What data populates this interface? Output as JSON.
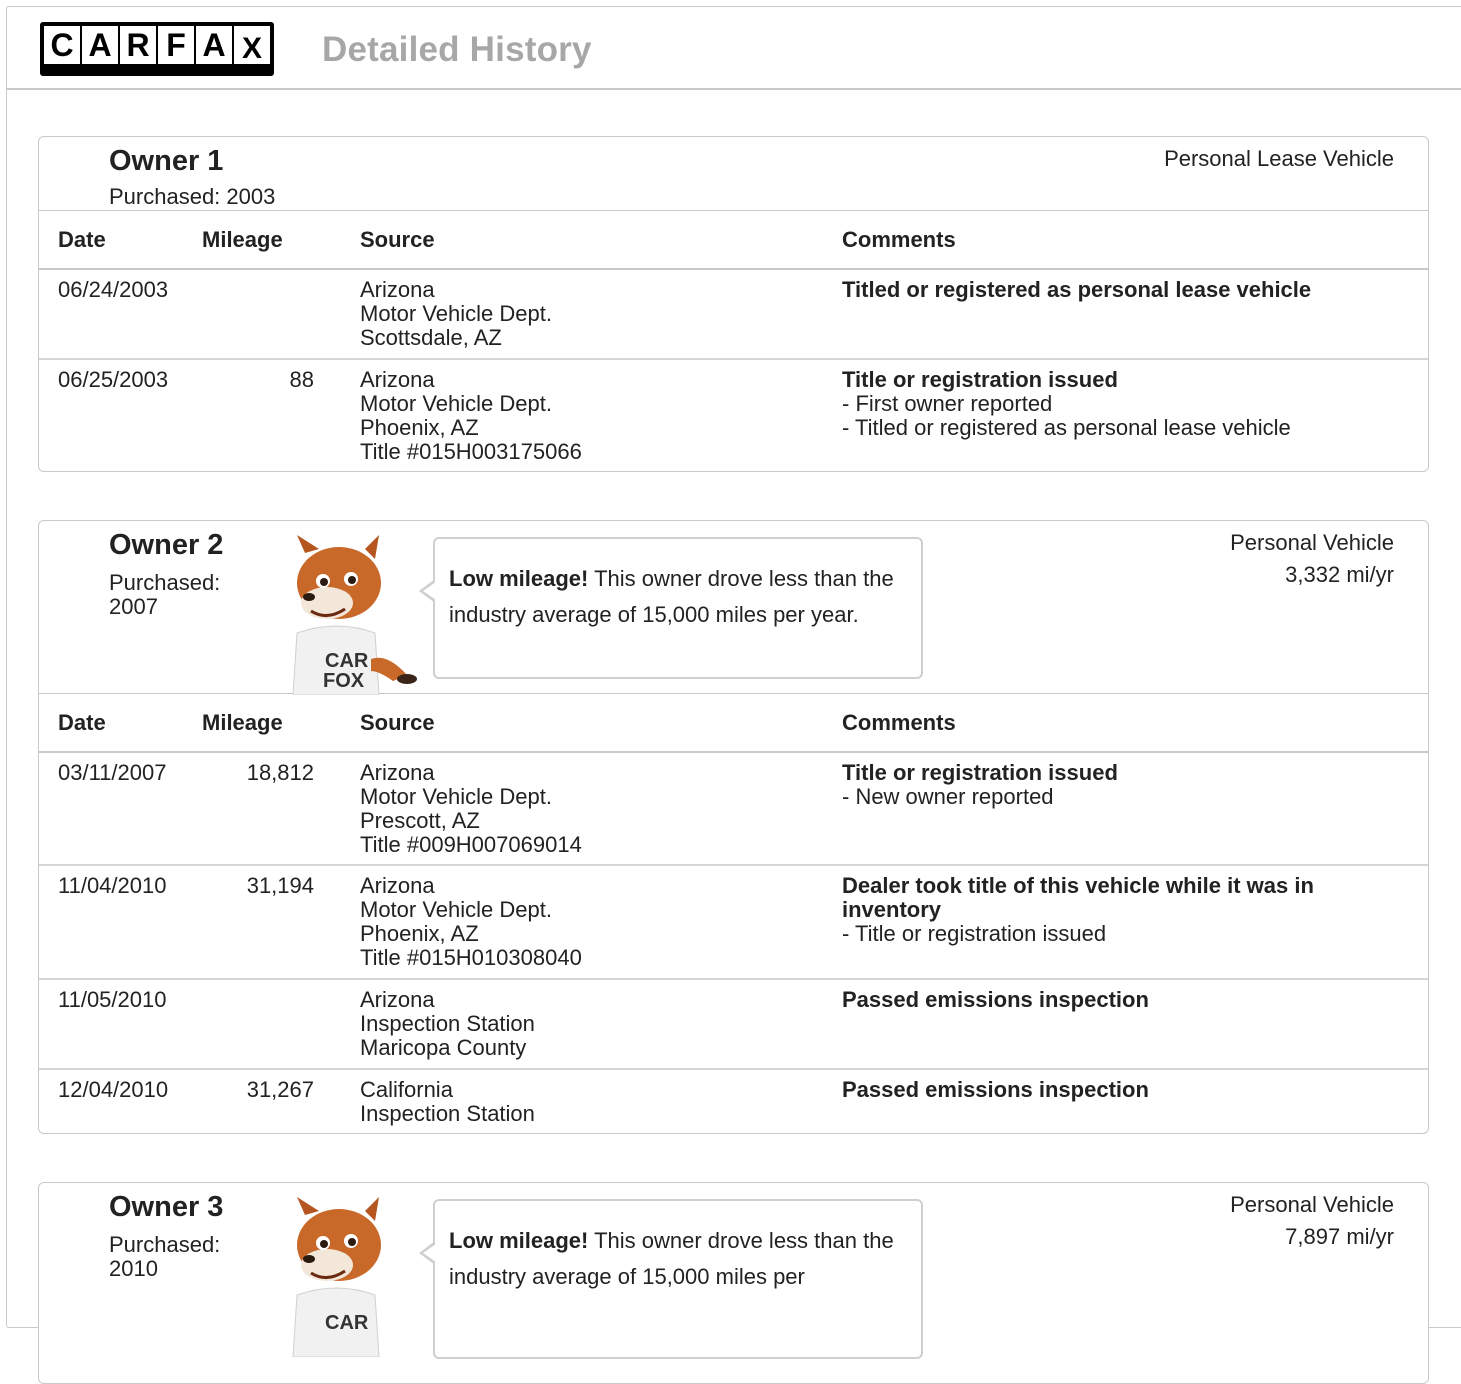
{
  "header": {
    "logo_letters": [
      "C",
      "A",
      "R",
      "F",
      "A",
      "X"
    ],
    "title": "Detailed History"
  },
  "columns": {
    "date": "Date",
    "mileage": "Mileage",
    "source": "Source",
    "comments": "Comments"
  },
  "owners": [
    {
      "name": "Owner 1",
      "purchased_label": "Purchased: 2003",
      "purchased_year": "",
      "vehicle_type": "Personal Lease Vehicle",
      "mileage_per_year": "",
      "rows": [
        {
          "date": "06/24/2003",
          "mileage": "",
          "source": [
            "Arizona",
            "Motor Vehicle Dept.",
            "Scottsdale, AZ"
          ],
          "comment_title": "Titled or registered as personal lease vehicle",
          "comment_details": []
        },
        {
          "date": "06/25/2003",
          "mileage": "88",
          "source": [
            "Arizona",
            "Motor Vehicle Dept.",
            "Phoenix, AZ",
            "Title #015H003175066"
          ],
          "comment_title": "Title or registration issued",
          "comment_details": [
            "- First owner reported",
            "- Titled or registered as personal lease vehicle"
          ]
        }
      ]
    },
    {
      "name": "Owner 2",
      "purchased_label": "Purchased:",
      "purchased_year": "2007",
      "vehicle_type": "Personal Vehicle",
      "mileage_per_year": "3,332 mi/yr",
      "bubble": {
        "bold": "Low mileage!",
        "text": " This owner drove less than the industry average of 15,000 miles per year."
      },
      "rows": [
        {
          "date": "03/11/2007",
          "mileage": "18,812",
          "source": [
            "Arizona",
            "Motor Vehicle Dept.",
            "Prescott, AZ",
            "Title #009H007069014"
          ],
          "comment_title": "Title or registration issued",
          "comment_details": [
            "- New owner reported"
          ]
        },
        {
          "date": "11/04/2010",
          "mileage": "31,194",
          "source": [
            "Arizona",
            "Motor Vehicle Dept.",
            "Phoenix, AZ",
            "Title #015H010308040"
          ],
          "comment_title": "Dealer took title of this vehicle while it was in inventory",
          "comment_details": [
            "- Title or registration issued"
          ]
        },
        {
          "date": "11/05/2010",
          "mileage": "",
          "source": [
            "Arizona",
            "Inspection Station",
            "Maricopa County"
          ],
          "comment_title": "Passed emissions inspection",
          "comment_details": []
        },
        {
          "date": "12/04/2010",
          "mileage": "31,267",
          "source": [
            "California",
            "Inspection Station"
          ],
          "comment_title": "Passed emissions inspection",
          "comment_details": []
        }
      ]
    },
    {
      "name": "Owner 3",
      "purchased_label": "Purchased:",
      "purchased_year": "2010",
      "vehicle_type": "Personal Vehicle",
      "mileage_per_year": "7,897 mi/yr",
      "bubble": {
        "bold": "Low mileage!",
        "text": " This owner drove less than the industry average of 15,000 miles per"
      },
      "rows": []
    }
  ]
}
